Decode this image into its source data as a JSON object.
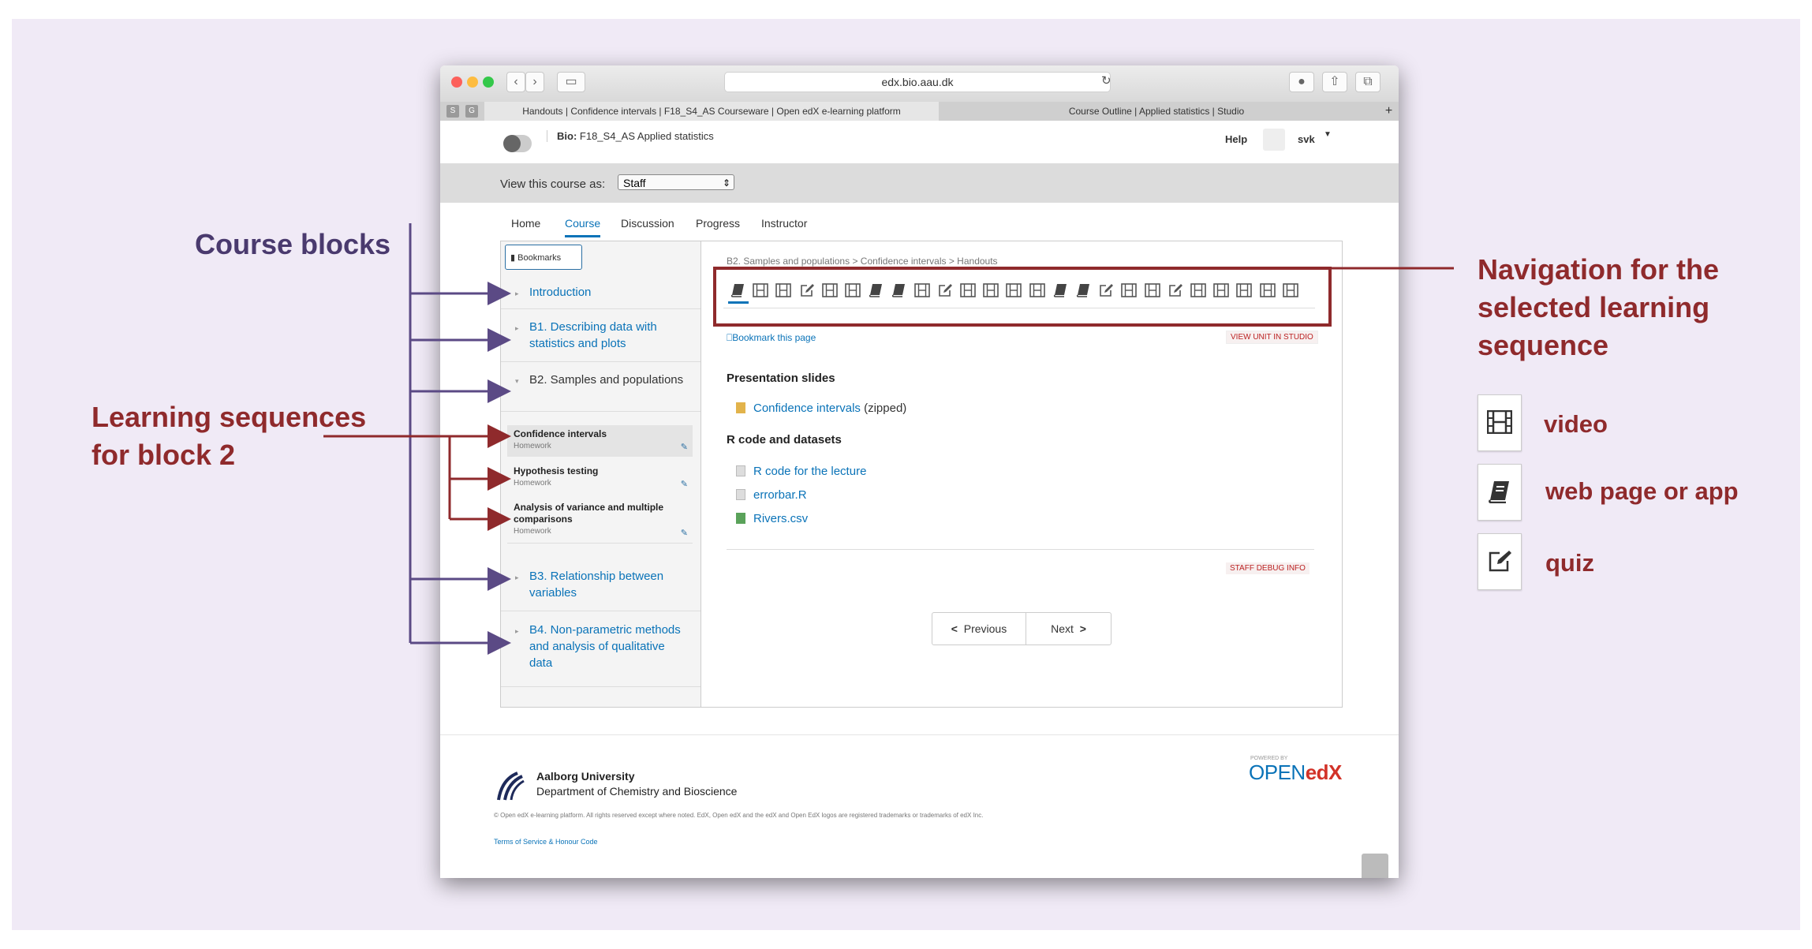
{
  "annotations": {
    "course_blocks": "Course blocks",
    "learning_sequences_l1": "Learning sequences",
    "learning_sequences_l2": "for block 2",
    "navigation_l1": "Navigation for the",
    "navigation_l2": "selected learning",
    "navigation_l3": "sequence"
  },
  "legend": [
    {
      "icon": "video-icon",
      "label": "video"
    },
    {
      "icon": "book-icon",
      "label": "web page or app"
    },
    {
      "icon": "quiz-icon",
      "label": "quiz"
    }
  ],
  "colors": {
    "annotation_purple": "#4a3a6e",
    "annotation_red": "#8f2a2c",
    "link_blue": "#0a73b8"
  },
  "browser": {
    "url": "edx.bio.aau.dk",
    "tabs": [
      "Handouts | Confidence intervals | F18_S4_AS Courseware | Open edX e-learning platform",
      "Course Outline | Applied statistics | Studio"
    ]
  },
  "header": {
    "course_prefix": "Bio:",
    "course_name": "F18_S4_AS Applied statistics",
    "help": "Help",
    "user": "svk"
  },
  "view_as": {
    "label": "View this course as:",
    "value": "Staff"
  },
  "nav_tabs": [
    "Home",
    "Course",
    "Discussion",
    "Progress",
    "Instructor"
  ],
  "sidebar": {
    "bookmarks": "Bookmarks",
    "blocks": [
      "Introduction",
      "B1. Describing data with statistics and plots",
      "B2. Samples and populations",
      "B3. Relationship between variables",
      "B4. Non-parametric methods and analysis of qualitative data"
    ],
    "sequences": [
      {
        "title": "Confidence intervals",
        "subtitle": "Homework"
      },
      {
        "title": "Hypothesis testing",
        "subtitle": "Homework"
      },
      {
        "title": "Analysis of variance and multiple comparisons",
        "subtitle": "Homework"
      }
    ]
  },
  "main": {
    "breadcrumb": "B2. Samples and populations > Confidence intervals > Handouts",
    "sequence_icons": [
      "book",
      "video",
      "video",
      "quiz",
      "video",
      "video",
      "book",
      "book",
      "video",
      "quiz",
      "video",
      "video",
      "video",
      "video",
      "book",
      "book",
      "quiz",
      "video",
      "video",
      "quiz",
      "video",
      "video",
      "video",
      "video",
      "video"
    ],
    "bookmark_page": "Bookmark this page",
    "view_in_studio": "VIEW UNIT IN STUDIO",
    "presentation_heading": "Presentation slides",
    "presentation_link": "Confidence intervals",
    "presentation_suffix": "(zipped)",
    "rcode_heading": "R code and datasets",
    "files": [
      "R code for the lecture",
      "errorbar.R",
      "Rivers.csv"
    ],
    "staff_debug": "STAFF DEBUG INFO",
    "previous": "Previous",
    "next": "Next"
  },
  "footer": {
    "university": "Aalborg University",
    "department": "Department of Chemistry and Bioscience",
    "copyright": "© Open edX e-learning platform. All rights reserved except where noted. EdX, Open edX and the edX and Open EdX logos are registered trademarks or trademarks of edX Inc.",
    "terms": "Terms of Service & Honour Code",
    "powered_by": "POWERED BY",
    "open": "OPEN",
    "edx": "edX"
  }
}
